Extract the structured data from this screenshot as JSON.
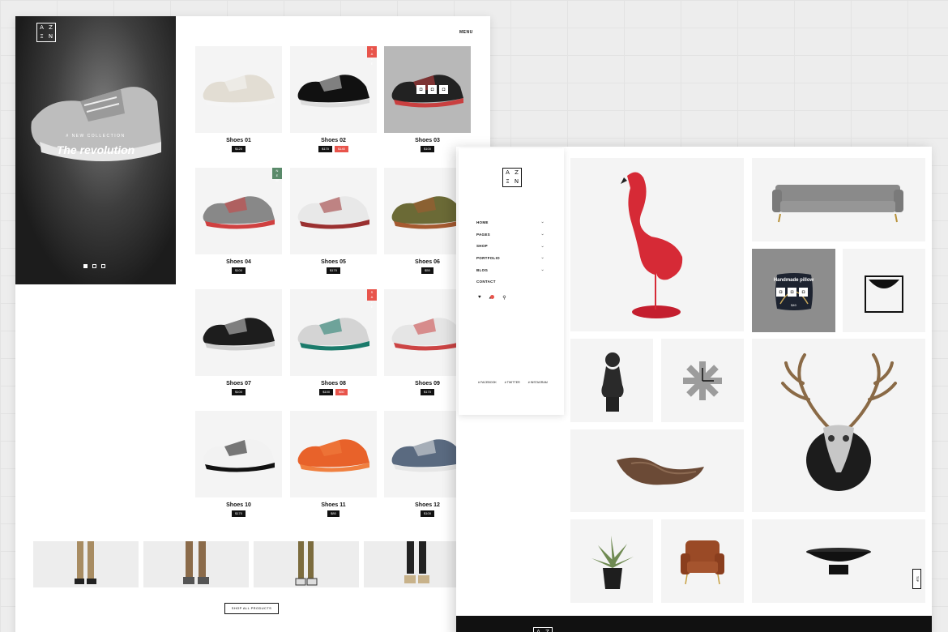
{
  "brand": {
    "logo_letters": [
      "A",
      "Z",
      "Ξ",
      "N"
    ]
  },
  "left": {
    "menu_label": "MENU",
    "hero": {
      "kicker": "# NEW COLLECTION",
      "title": "The revolution"
    },
    "products": [
      {
        "name": "Shoes 01",
        "prices": [
          "$120"
        ],
        "badge": ""
      },
      {
        "name": "Shoes 02",
        "prices": [
          "$170",
          "$140"
        ],
        "badge": "SALE"
      },
      {
        "name": "Shoes 03",
        "prices": [
          "$100"
        ],
        "badge": ""
      },
      {
        "name": "Shoes 04",
        "prices": [
          "$100"
        ],
        "badge": "NEW"
      },
      {
        "name": "Shoes 05",
        "prices": [
          "$170"
        ],
        "badge": ""
      },
      {
        "name": "Shoes 06",
        "prices": [
          "$50"
        ],
        "badge": ""
      },
      {
        "name": "Shoes 07",
        "prices": [
          "$100"
        ],
        "badge": ""
      },
      {
        "name": "Shoes 08",
        "prices": [
          "$100",
          "$50"
        ],
        "badge": "SALE"
      },
      {
        "name": "Shoes 09",
        "prices": [
          "$170"
        ],
        "badge": ""
      },
      {
        "name": "Shoes 10",
        "prices": [
          "$170"
        ],
        "badge": ""
      },
      {
        "name": "Shoes 11",
        "prices": [
          "$80"
        ],
        "badge": ""
      },
      {
        "name": "Shoes 12",
        "prices": [
          "$100"
        ],
        "badge": ""
      }
    ],
    "shop_all": "SHOP ALL PRODUCTS"
  },
  "right": {
    "nav": [
      "HOME",
      "PAGES",
      "SHOP",
      "PORTFOLIO",
      "BLOG",
      "CONTACT"
    ],
    "nav_chevron": "⌄",
    "social": [
      "# FACEBOOK",
      "# TWITTER",
      "# INSTAGRAM"
    ],
    "pillow": {
      "label": "Handmade pillow",
      "price": "$40"
    },
    "scroll_top": "TOP"
  },
  "colors": {
    "accent_sale": "#e8544b",
    "accent_new": "#5a8a6a",
    "dark": "#111111"
  }
}
